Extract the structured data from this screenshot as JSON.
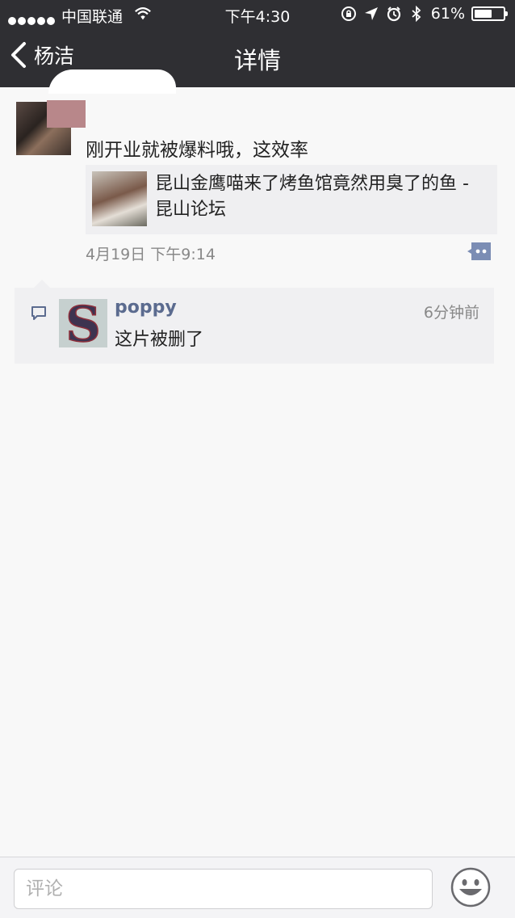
{
  "status_bar": {
    "carrier": "中国联通",
    "time": "下午4:30",
    "battery_text": "61%",
    "battery_level": 0.61
  },
  "nav": {
    "back_label": "杨洁",
    "title": "详情"
  },
  "post": {
    "text": "刚开业就被爆料哦，这效率",
    "link_title": "昆山金鹰喵来了烤鱼馆竟然用臭了的鱼 - 昆山论坛",
    "date": "4月19日  下午9:14"
  },
  "comments": [
    {
      "author": "poppy",
      "time": "6分钟前",
      "text": "这片被删了",
      "avatar_letter": "S"
    }
  ],
  "bottom_bar": {
    "input_placeholder": "评论",
    "input_value": ""
  },
  "icons": {
    "back": "chevron-left-icon",
    "wifi": "wifi-icon",
    "lock": "rotation-lock-icon",
    "location": "location-arrow-icon",
    "alarm": "alarm-icon",
    "bluetooth": "bluetooth-icon",
    "comment": "comment-bubble-icon",
    "emoji": "emoji-smile-icon"
  },
  "colors": {
    "header_bg": "#2f2f33",
    "author_name": "#5b6b8f",
    "comment_toggle": "#7b8db4"
  }
}
